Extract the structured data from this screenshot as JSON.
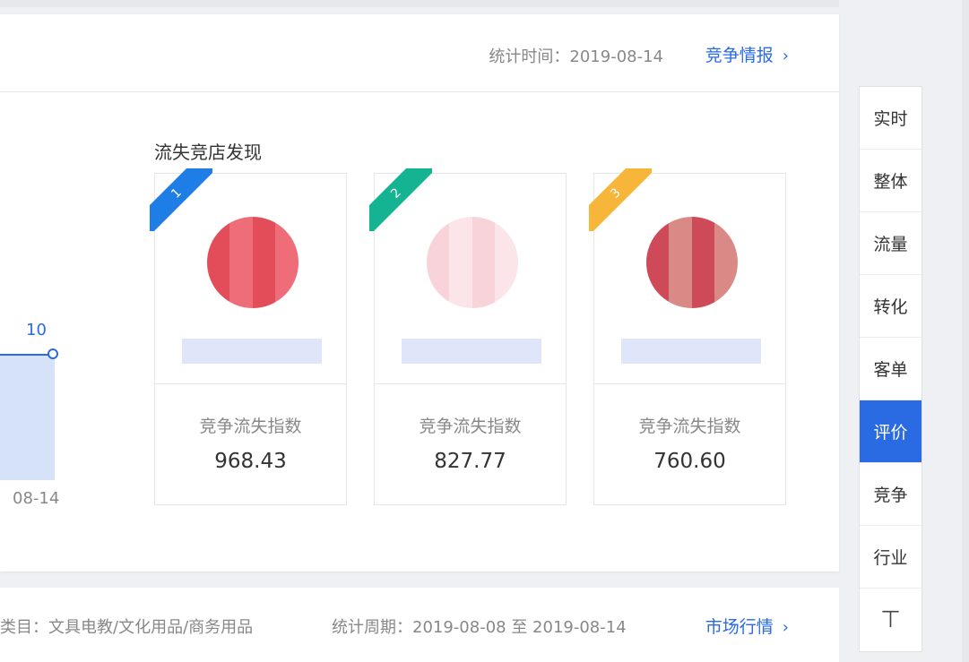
{
  "header": {
    "stat_time": "统计时间：2019-08-14",
    "link_label": "竞争情报",
    "link_chevron": "›"
  },
  "chart": {
    "value_label": "10",
    "x_tick": "08-14"
  },
  "section": {
    "title": "流失竞店发现"
  },
  "shops": [
    {
      "rank": "1",
      "label": "竞争流失指数",
      "value": "968.43"
    },
    {
      "rank": "2",
      "label": "竞争流失指数",
      "value": "827.77"
    },
    {
      "rank": "3",
      "label": "竞争流失指数",
      "value": "760.60"
    }
  ],
  "bottom": {
    "category": "类目：文具电教/文化用品/商务用品",
    "period": "统计周期：2019-08-08 至 2019-08-14",
    "link_label": "市场行情",
    "link_chevron": "›"
  },
  "side_nav": {
    "items": [
      "实时",
      "整体",
      "流量",
      "转化",
      "客单",
      "评价",
      "竞争",
      "行业"
    ],
    "active": "评价",
    "back_to_top_icon": "⊤"
  },
  "colors": {
    "accent": "#2a6be3",
    "rank1": "#1f7ee5",
    "rank2": "#14b391",
    "rank3": "#f7b53a"
  }
}
